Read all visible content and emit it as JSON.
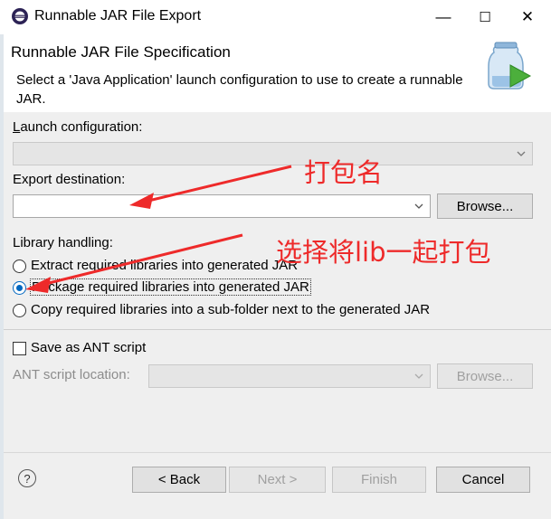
{
  "window": {
    "title": "Runnable JAR File Export",
    "controls": [
      "—",
      "☐",
      "✕"
    ]
  },
  "header": {
    "title": "Runnable JAR File Specification",
    "description": "Select a 'Java Application' launch configuration to use to create a runnable JAR."
  },
  "launch": {
    "label": "Launch configuration:",
    "value": ""
  },
  "export": {
    "label": "Export destination:",
    "value": "",
    "browse": "Browse..."
  },
  "library": {
    "label": "Library handling:",
    "options": [
      "Extract required libraries into generated JAR",
      "Package required libraries into generated JAR",
      "Copy required libraries into a sub-folder next to the generated JAR"
    ],
    "selected_index": 1
  },
  "ant": {
    "checkbox_label": "Save as ANT script",
    "checked": false,
    "location_label": "ANT script location:",
    "browse": "Browse..."
  },
  "footer": {
    "help": "?",
    "back": "< Back",
    "next": "Next >",
    "finish": "Finish",
    "cancel": "Cancel"
  },
  "annotations": {
    "name": "打包名",
    "lib": "选择将lib一起打包"
  },
  "colors": {
    "annotation": "#ee2a2a",
    "radio_selected": "#0067c0"
  }
}
